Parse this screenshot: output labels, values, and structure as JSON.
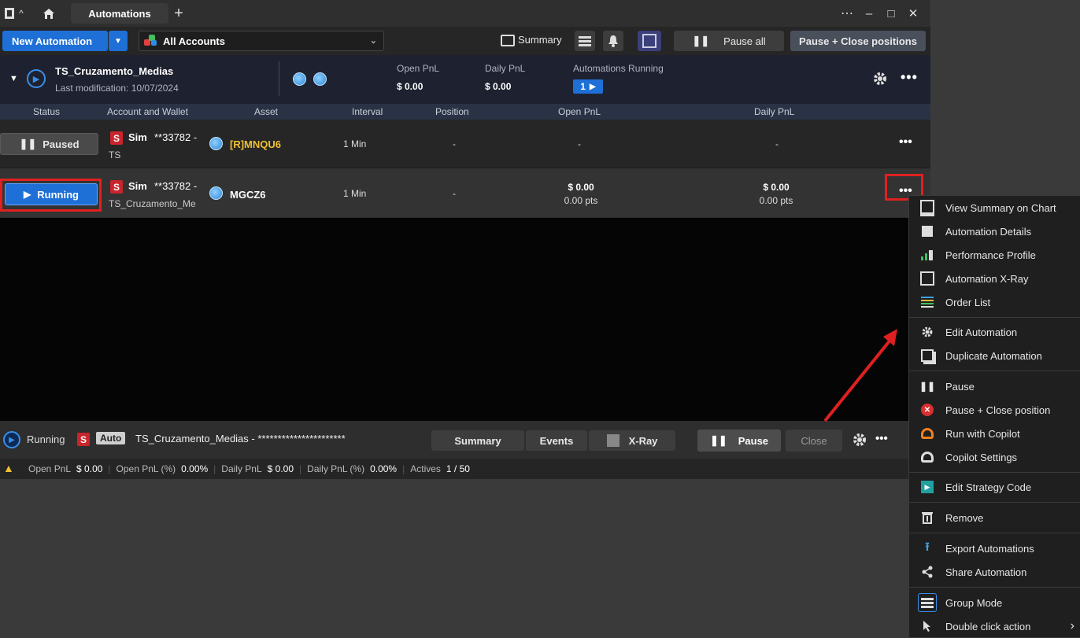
{
  "titlebar": {
    "tab_label": "Automations",
    "add_tab": "+",
    "more_icon": "⋯",
    "minimize": "–",
    "maximize": "□",
    "close": "✕"
  },
  "toolbar": {
    "new_automation": "New Automation",
    "accounts": "All Accounts",
    "summary": "Summary",
    "pause_all": "Pause all",
    "pause_close": "Pause + Close positions"
  },
  "group": {
    "name": "TS_Cruzamento_Medias",
    "last_mod": "Last modification: 10/07/2024",
    "open_pnl_label": "Open PnL",
    "open_pnl": "$ 0.00",
    "daily_pnl_label": "Daily PnL",
    "daily_pnl": "$ 0.00",
    "running_label": "Automations Running",
    "running_count": "1"
  },
  "columns": [
    "Status",
    "Account and Wallet",
    "Asset",
    "Interval",
    "Position",
    "Open PnL",
    "Daily PnL"
  ],
  "rows": [
    {
      "status": "Paused",
      "badge": "S",
      "account": "Sim",
      "wallet": "**33782 -",
      "sub": "TS",
      "asset": "[R]MNQU6",
      "interval": "1 Min",
      "position": "-",
      "open_pnl": "-",
      "open_pts": "",
      "daily_pnl": "-",
      "daily_pts": ""
    },
    {
      "status": "Running",
      "badge": "S",
      "account": "Sim",
      "wallet": "**33782 -",
      "sub": "TS_Cruzamento_Me",
      "asset": "MGCZ6",
      "interval": "1 Min",
      "position": "-",
      "open_pnl": "$ 0.00",
      "open_pts": "0.00 pts",
      "daily_pnl": "$ 0.00",
      "daily_pts": "0.00 pts"
    }
  ],
  "statusbar": {
    "state": "Running",
    "badge": "S",
    "auto": "Auto",
    "name": "TS_Cruzamento_Medias - **********************",
    "summary_tab": "Summary",
    "events_tab": "Events",
    "xray_tab": "X-Ray",
    "pause": "Pause",
    "close": "Close"
  },
  "footer": {
    "open_pnl_label": "Open PnL",
    "open_pnl": "$ 0.00",
    "open_pct_label": "Open PnL (%)",
    "open_pct": "0.00%",
    "daily_pnl_label": "Daily PnL",
    "daily_pnl": "$ 0.00",
    "daily_pct_label": "Daily PnL (%)",
    "daily_pct": "0.00%",
    "actives_label": "Actives",
    "actives": "1 / 50"
  },
  "menu": [
    {
      "label": "View Summary on Chart",
      "icon": "chart-summary-icon"
    },
    {
      "label": "Automation Details",
      "icon": "automation-details-icon"
    },
    {
      "label": "Performance Profile",
      "icon": "performance-icon"
    },
    {
      "label": "Automation X-Ray",
      "icon": "xray-icon"
    },
    {
      "label": "Order List",
      "icon": "order-list-icon"
    },
    {
      "label": "Edit Automation",
      "icon": "gear-icon"
    },
    {
      "label": "Duplicate Automation",
      "icon": "duplicate-icon"
    },
    {
      "label": "Pause",
      "icon": "pause-icon"
    },
    {
      "label": "Pause + Close position",
      "icon": "close-circle-icon"
    },
    {
      "label": "Run with Copilot",
      "icon": "copilot-icon"
    },
    {
      "label": "Copilot Settings",
      "icon": "copilot-settings-icon"
    },
    {
      "label": "Edit Strategy Code",
      "icon": "code-icon"
    },
    {
      "label": "Remove",
      "icon": "trash-icon"
    },
    {
      "label": "Export Automations",
      "icon": "export-icon"
    },
    {
      "label": "Share Automation",
      "icon": "share-icon"
    },
    {
      "label": "Group Mode",
      "icon": "group-mode-icon"
    },
    {
      "label": "Double click action",
      "icon": "cursor-icon"
    }
  ],
  "colors": {
    "accent": "#1e6fd6",
    "highlight": "#e02020",
    "asset_yellow": "#f0c030"
  }
}
